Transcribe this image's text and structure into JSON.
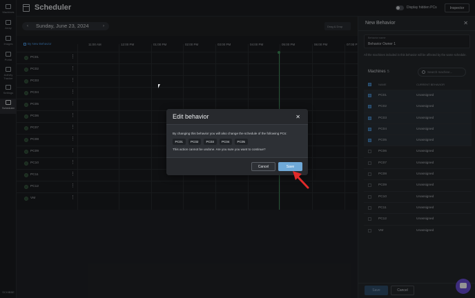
{
  "nav": {
    "items": [
      {
        "label": "Machines",
        "icon": "monitor-icon"
      },
      {
        "label": "Array",
        "icon": "list-icon"
      },
      {
        "label": "Images",
        "icon": "gear-icon"
      },
      {
        "label": "Portal",
        "icon": "pin-icon"
      },
      {
        "label": "Activity Tracker",
        "icon": "activity-icon"
      },
      {
        "label": "Settings",
        "icon": "settings-icon"
      },
      {
        "label": "Scheduler",
        "icon": "calendar-icon"
      }
    ],
    "bottom_label": "SCHIBBE"
  },
  "header": {
    "title": "Scheduler",
    "toggle_label": "Display hidden PCs",
    "inspector_label": "Inspector"
  },
  "datebar": {
    "date": "Sunday, June 23, 2024",
    "prev_glyph": "‹",
    "next_glyph": "›",
    "drag_label": "Drag & Drop"
  },
  "grid": {
    "behavior_header": "By New Behavior",
    "times": [
      "11:00 AM",
      "12:00 PM",
      "01:00 PM",
      "02:00 PM",
      "03:00 PM",
      "04:00 PM",
      "05:00 PM",
      "06:00 PM",
      "07:00 P"
    ],
    "rows": [
      "PC01",
      "PC02",
      "PC03",
      "PC04",
      "PC05",
      "PC06",
      "PC07",
      "PC08",
      "PC09",
      "PC10",
      "PC11",
      "PC12",
      "VM"
    ],
    "kebab": "⋮"
  },
  "panel": {
    "title": "New Behavior",
    "close_glyph": "✕",
    "name_label": "Behavior name",
    "name_value": "Behavior Owner 1",
    "info": "All the machines included in this behavior will be affected by the same schedule.",
    "machines_label": "Machines",
    "machines_count": "5",
    "search_placeholder": "Search machine...",
    "col_name": "NAME",
    "col_behavior": "CURRENT BEHAVIOR",
    "rows": [
      {
        "name": "PC01",
        "behavior": "Unassigned",
        "selected": true
      },
      {
        "name": "PC02",
        "behavior": "Unassigned",
        "selected": true
      },
      {
        "name": "PC03",
        "behavior": "Unassigned",
        "selected": true
      },
      {
        "name": "PC04",
        "behavior": "Unassigned",
        "selected": true
      },
      {
        "name": "PC05",
        "behavior": "Unassigned",
        "selected": true
      },
      {
        "name": "PC06",
        "behavior": "Unassigned",
        "selected": false
      },
      {
        "name": "PC07",
        "behavior": "Unassigned",
        "selected": false
      },
      {
        "name": "PC08",
        "behavior": "Unassigned",
        "selected": false
      },
      {
        "name": "PC09",
        "behavior": "Unassigned",
        "selected": false
      },
      {
        "name": "PC10",
        "behavior": "Unassigned",
        "selected": false
      },
      {
        "name": "PC11",
        "behavior": "Unassigned",
        "selected": false
      },
      {
        "name": "PC12",
        "behavior": "Unassigned",
        "selected": false
      },
      {
        "name": "VM",
        "behavior": "Unassigned",
        "selected": false
      }
    ],
    "save_label": "Save",
    "cancel_label": "Cancel"
  },
  "modal": {
    "title": "Edit behavior",
    "close_glyph": "✕",
    "message": "By changing this behavior you will also change the schedule of the following PCs:",
    "pcs": [
      "PC01",
      "PC02",
      "PC03",
      "PC04",
      "PC05"
    ],
    "warning": "This action cannot be undone. Are you sure you want to continue?",
    "cancel_label": "Cancel",
    "save_label": "Save"
  },
  "colors": {
    "accent": "#6fa9d8",
    "now_line": "#3f8f5a",
    "annotation_arrow": "#e02a2a",
    "chat": "#6c4fd8"
  }
}
